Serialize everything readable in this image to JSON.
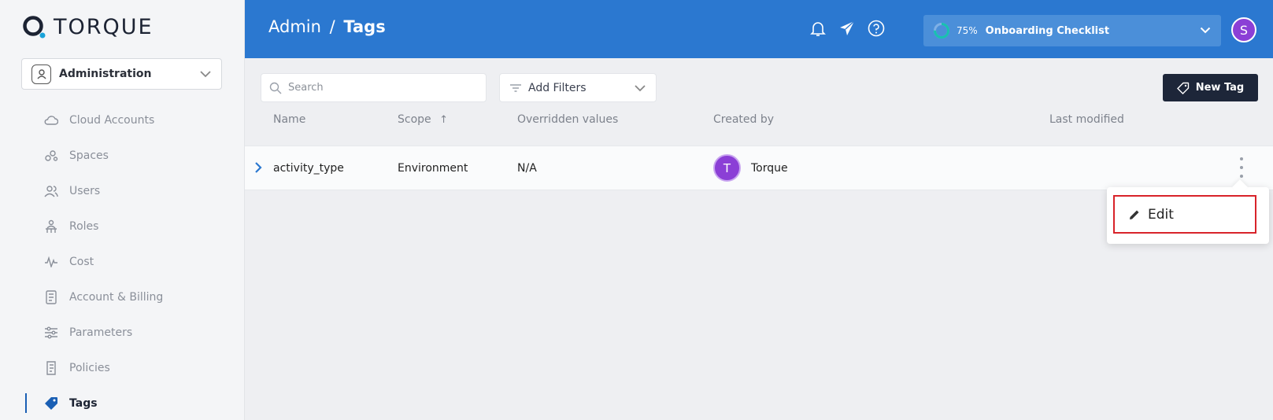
{
  "brand": {
    "name": "TORQUE"
  },
  "workspace": {
    "label": "Administration"
  },
  "sidebar": {
    "items": [
      {
        "label": "Cloud Accounts",
        "icon": "cloud-icon",
        "active": false
      },
      {
        "label": "Spaces",
        "icon": "spaces-icon",
        "active": false
      },
      {
        "label": "Users",
        "icon": "users-icon",
        "active": false
      },
      {
        "label": "Roles",
        "icon": "roles-icon",
        "active": false
      },
      {
        "label": "Cost",
        "icon": "pulse-icon",
        "active": false
      },
      {
        "label": "Account & Billing",
        "icon": "billing-icon",
        "active": false
      },
      {
        "label": "Parameters",
        "icon": "sliders-icon",
        "active": false
      },
      {
        "label": "Policies",
        "icon": "policy-icon",
        "active": false
      },
      {
        "label": "Tags",
        "icon": "tag-icon",
        "active": true
      }
    ]
  },
  "header": {
    "breadcrumb_parent": "Admin",
    "breadcrumb_sep": "/",
    "breadcrumb_current": "Tags",
    "onboarding_percent": "75%",
    "onboarding_progress": 0.75,
    "onboarding_label": "Onboarding Checklist",
    "user_initial": "S"
  },
  "toolbar": {
    "search_placeholder": "Search",
    "filters_label": "Add Filters",
    "new_tag_label": "New Tag"
  },
  "table": {
    "columns": [
      "Name",
      "Scope",
      "Overridden values",
      "Created by",
      "Last modified"
    ],
    "sort_indicator": "↑",
    "rows": [
      {
        "name": "activity_type",
        "scope": "Environment",
        "overridden": "N/A",
        "creator_initial": "T",
        "creator": "Torque",
        "last_modified": ""
      }
    ]
  },
  "menu": {
    "edit_label": "Edit"
  },
  "colors": {
    "header": "#2b78d0",
    "accent_purple": "#8b3fd6",
    "button_dark": "#1d2639",
    "highlight_red": "#d8232a"
  }
}
